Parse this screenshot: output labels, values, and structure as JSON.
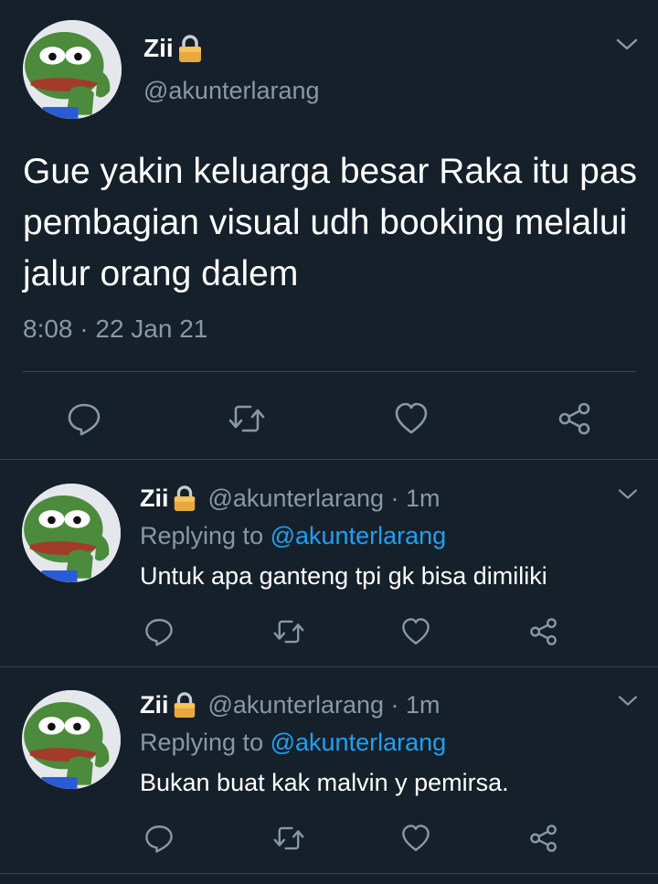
{
  "main_tweet": {
    "author_name": "Zii",
    "handle": "@akunterlarang",
    "text": "Gue yakin keluarga besar Raka itu pas pembagian visual udh booking melalui jalur orang dalem",
    "timestamp": "8:08 · 22 Jan 21",
    "icons": [
      "reply-icon",
      "retweet-icon",
      "like-icon",
      "share-icon"
    ]
  },
  "replies": [
    {
      "author_name": "Zii",
      "meta": "@akunterlarang · 1m",
      "replying_prefix": "Replying to",
      "replying_mention": "@akunterlarang",
      "text": "Untuk apa ganteng tpi gk bisa dimiliki"
    },
    {
      "author_name": "Zii",
      "meta": "@akunterlarang · 1m",
      "replying_prefix": "Replying to",
      "replying_mention": "@akunterlarang",
      "text": "Bukan buat kak malvin y pemirsa."
    }
  ],
  "colors": {
    "background": "#15202b",
    "secondary_text": "#8899a6",
    "accent": "#1da1f2",
    "divider": "#38444d"
  }
}
